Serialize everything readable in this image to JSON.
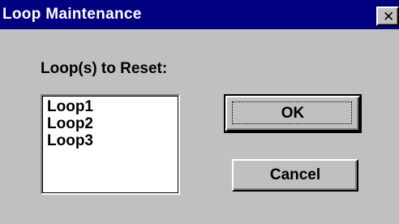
{
  "window": {
    "title": "Loop Maintenance",
    "close_glyph": "✕"
  },
  "form": {
    "label": "Loop(s) to Reset:",
    "loops": [
      "Loop1",
      "Loop2",
      "Loop3"
    ]
  },
  "buttons": {
    "ok_label": "OK",
    "cancel_label": "Cancel"
  },
  "colors": {
    "titlebar": "#000080",
    "face": "#c0c0c0",
    "title_text": "#ffffff"
  }
}
